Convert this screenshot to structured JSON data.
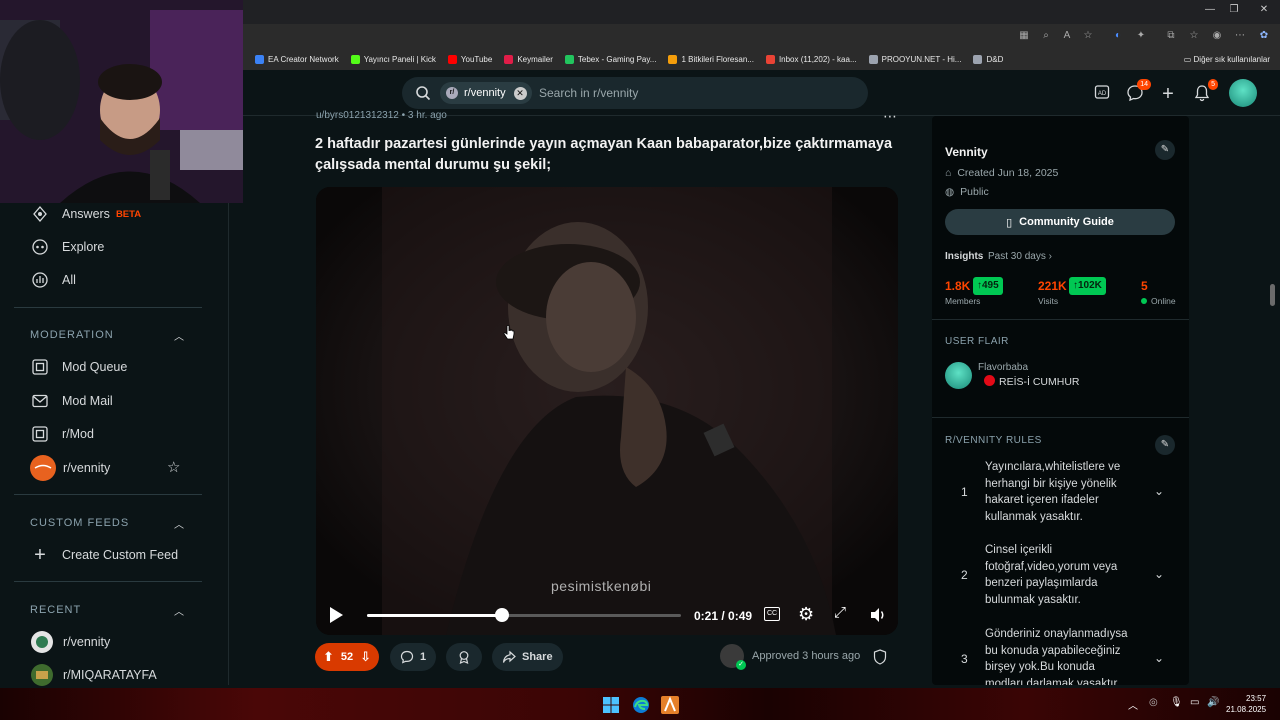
{
  "browser": {
    "bookmarks": [
      {
        "label": "EA Creator Network",
        "color": "#3b82f6"
      },
      {
        "label": "Yayıncı Paneli | Kick",
        "color": "#53fc18"
      },
      {
        "label": "YouTube",
        "color": "#ff0000"
      },
      {
        "label": "Keymailer",
        "color": "#e11d48"
      },
      {
        "label": "Tebex - Gaming Pay...",
        "color": "#22c55e"
      },
      {
        "label": "1 Bitkileri Floresan...",
        "color": "#f59e0b"
      },
      {
        "label": "Inbox (11,202) - kaa...",
        "color": "#ea4335"
      },
      {
        "label": "PROOYUN.NET - Hi...",
        "color": "#9ca3af"
      },
      {
        "label": "D&D",
        "color": "#9ca3af"
      }
    ],
    "other_bookmarks": "Diğer sık kullanılanlar"
  },
  "header": {
    "search_chip": "r/vennity",
    "search_placeholder": "Search in r/vennity",
    "chat_badge": "14",
    "notif_badge": "5"
  },
  "leftnav": {
    "answers": "Answers",
    "answers_badge": "BETA",
    "explore": "Explore",
    "all": "All",
    "moderation_header": "MODERATION",
    "mod_queue": "Mod Queue",
    "mod_mail": "Mod Mail",
    "r_mod": "r/Mod",
    "r_vennity": "r/vennity",
    "custom_feeds_header": "CUSTOM FEEDS",
    "create_custom_feed": "Create Custom Feed",
    "recent_header": "RECENT",
    "recent_items": [
      "r/vennity",
      "r/MIQARATAYFA"
    ]
  },
  "post": {
    "author": "u/byrs0121312312",
    "time": "3 hr. ago",
    "title": "2 haftadır pazartesi günlerinde yayın açmayan Kaan babaparator,bize çaktırmamaya çalışsada mental durumu şu şekil;",
    "video": {
      "watermark": "pesimistkenøbi",
      "time_display": "0:21 / 0:49",
      "progress": 0.43
    },
    "votes": "52",
    "comments": "1",
    "share": "Share",
    "approved": "Approved 3 hours ago"
  },
  "sidebar": {
    "name": "Vennity",
    "created": "Created Jun 18, 2025",
    "visibility": "Public",
    "community_guide": "Community Guide",
    "insights_label": "Insights",
    "insights_period": "Past 30 days",
    "members_value": "1.8K",
    "members_delta": "495",
    "members_label": "Members",
    "visits_value": "221K",
    "visits_delta": "102K",
    "visits_label": "Visits",
    "online_value": "5",
    "online_label": "Online",
    "user_flair_header": "USER FLAIR",
    "flair_user": "Flavorbaba",
    "flair_text": "REİS-İ CUMHUR",
    "rules_header": "R/VENNITY RULES",
    "rules": [
      {
        "num": "1",
        "text": "Yayıncılara,whitelistlere ve herhangi bir kişiye yönelik hakaret içeren ifadeler kullanmak yasaktır."
      },
      {
        "num": "2",
        "text": "Cinsel içerikli fotoğraf,video,yorum veya benzeri paylaşımlarda bulunmak yasaktır."
      },
      {
        "num": "3",
        "text": "Gönderiniz onaylanmadıysa bu konuda yapabileceğiniz birşey yok.Bu konuda modları darlamak yasaktır."
      }
    ]
  },
  "taskbar": {
    "time": "23:57",
    "date": "21.08.2025"
  }
}
